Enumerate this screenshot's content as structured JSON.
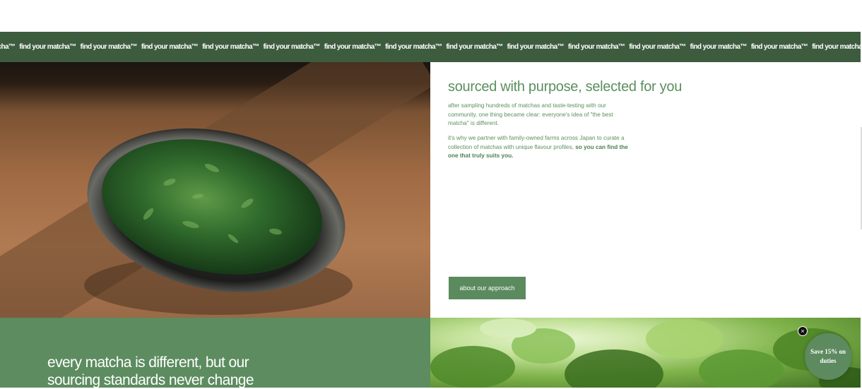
{
  "marquee": {
    "items": [
      "find your matcha™",
      "find your matcha™",
      "find your matcha™",
      "find your matcha™",
      "find your matcha™",
      "find your matcha™",
      "find your matcha™",
      "find your matcha™",
      "find your matcha™",
      "find your matcha™",
      "find your matcha™",
      "find your matcha™",
      "find your matcha™",
      "find your matcha™",
      "find your matcha™"
    ]
  },
  "sourcing": {
    "heading": "sourced with purpose, selected for you",
    "paragraph_1": "after sampling hundreds of matchas and taste-testing with our community, one thing became clear: everyone's idea of \"the best matcha\" is different.",
    "paragraph_2_lead": "it's why we partner with family-owned farms across Japan to curate a collection of matchas with unique flavour profiles,",
    "paragraph_2_emphasis": "so you can find the one that truly suits you.",
    "button_label": "about our approach"
  },
  "standards": {
    "heading": "every matcha is different, but our sourcing standards never change"
  },
  "popup": {
    "close_label": "×",
    "promo_text": "Save 15% on duties"
  },
  "colors": {
    "marquee_bg": "#3d5c3e",
    "accent_green": "#5b8f5e",
    "standards_bg": "#5c8c5f",
    "button_bg": "#5a8a5d"
  }
}
